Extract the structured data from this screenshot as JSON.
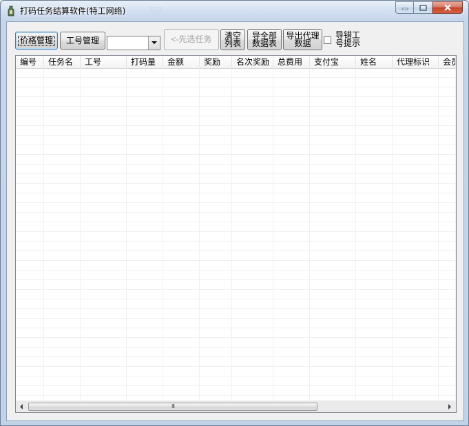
{
  "window": {
    "title": "打码任务结算软件(特工网络)",
    "title_ghost": "3G3"
  },
  "toolbar": {
    "price_manage": "价格管理",
    "worker_id_manage": "工号管理",
    "task_combo_value": "",
    "select_task_first": "<-先选任务",
    "clear_list_line1": "清空",
    "clear_list_line2": "列表",
    "export_all_line1": "导全部",
    "export_all_line2": "数据表",
    "export_agent_line1": "导出代理",
    "export_agent_line2": "数据",
    "wrong_id_line1": "导错工",
    "wrong_id_line2": "号提示",
    "wrong_id_checked": false
  },
  "table": {
    "columns": [
      "编号",
      "任务名",
      "工号",
      "打码量",
      "金额",
      "奖励",
      "名次奖励",
      "总费用",
      "支付宝",
      "姓名",
      "代理标识",
      "会员"
    ],
    "rows": []
  },
  "scrollbar": {
    "grip": "III"
  },
  "colors": {
    "title_bar": "#c6d6ea",
    "close_button": "#c2452b",
    "client_bg": "#f0f0f0"
  }
}
